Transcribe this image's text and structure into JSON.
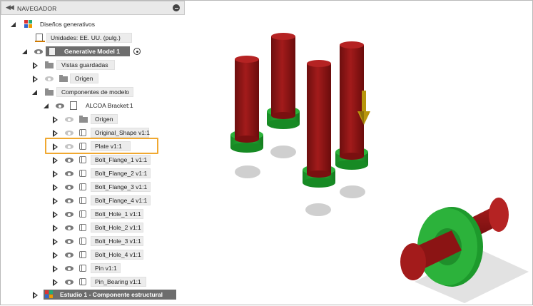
{
  "browser": {
    "header": {
      "title": "NAVEGADOR",
      "collapse_icon": "double-left-arrow-icon",
      "close_icon": "minus-circle-icon"
    },
    "root": {
      "label": "Diseños generativos"
    },
    "units": {
      "label": "Unidades: EE. UU. (pulg.)"
    },
    "model": {
      "label": "Generative Model 1"
    },
    "saved_views": {
      "label": "Vistas guardadas"
    },
    "origin": {
      "label": "Origen"
    },
    "model_components": {
      "label": "Componentes de modelo"
    },
    "bracket": {
      "label": "ALCOA Bracket:1"
    },
    "bracket_items": [
      {
        "label": "Origen"
      },
      {
        "label": "Original_Shape v1:1"
      },
      {
        "label": "Plate v1:1"
      },
      {
        "label": "Bolt_Flange_1 v1:1"
      },
      {
        "label": "Bolt_Flange_2 v1:1"
      },
      {
        "label": "Bolt_Flange_3 v1:1"
      },
      {
        "label": "Bolt_Flange_4 v1:1"
      },
      {
        "label": "Bolt_Hole_1 v1:1"
      },
      {
        "label": "Bolt_Hole_2 v1:1"
      },
      {
        "label": "Bolt_Hole_3 v1:1"
      },
      {
        "label": "Bolt_Hole_4 v1:1"
      },
      {
        "label": "Pin v1:1"
      },
      {
        "label": "Pin_Bearing v1:1"
      }
    ],
    "study": {
      "label": "Estudio 1 - Componente estructural"
    }
  },
  "colors": {
    "pillar_red": "#8b1414",
    "flange_green": "#1f9a2e",
    "load_arrow": "#b8950c",
    "highlight": "#f0a830",
    "row_bar": "#ececec",
    "dark_bar": "#6d6d6d"
  }
}
